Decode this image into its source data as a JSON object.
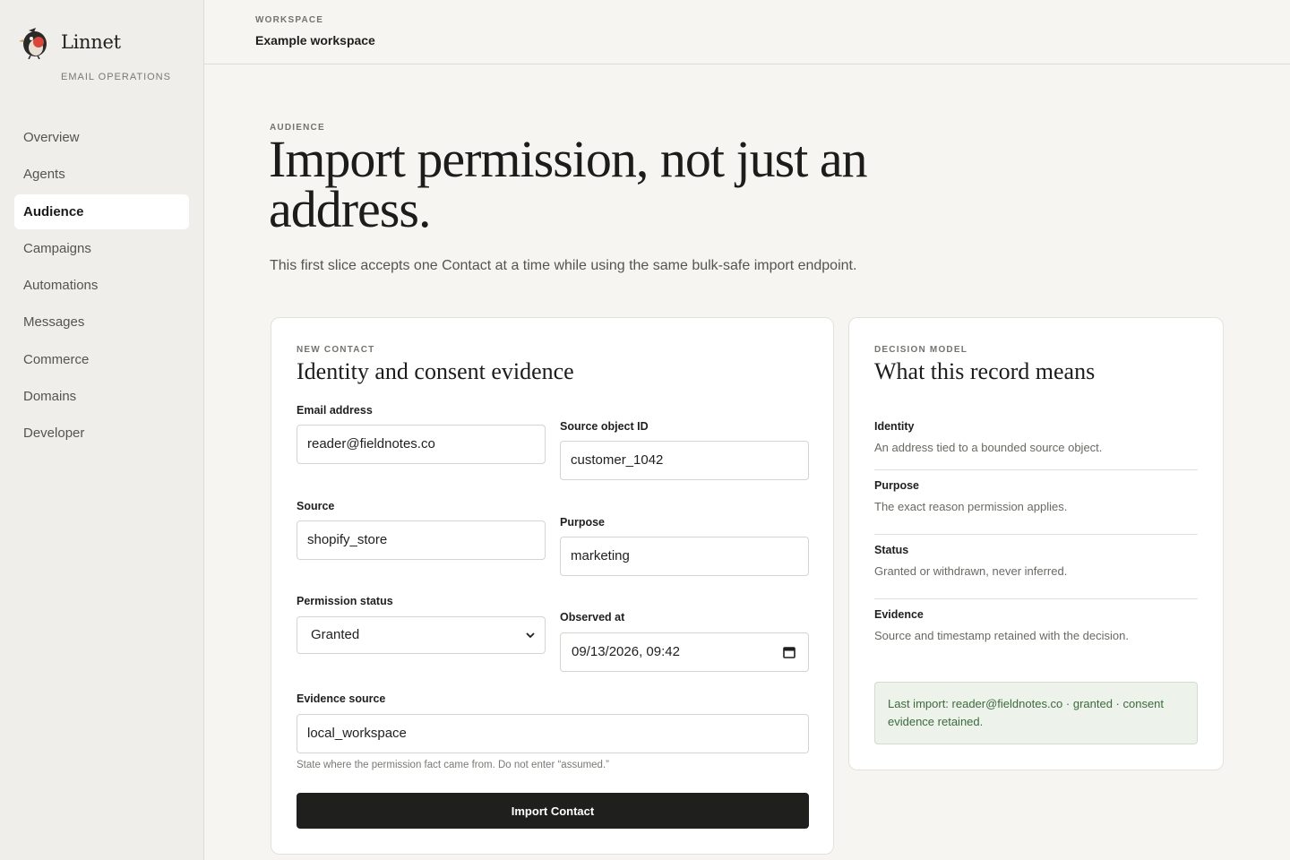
{
  "brand": {
    "name": "Linnet",
    "tagline": "EMAIL OPERATIONS",
    "logo_icon": "bird-logo-icon"
  },
  "sidebar": {
    "items": [
      {
        "label": "Overview",
        "active": false
      },
      {
        "label": "Agents",
        "active": false
      },
      {
        "label": "Audience",
        "active": true
      },
      {
        "label": "Campaigns",
        "active": false
      },
      {
        "label": "Automations",
        "active": false
      },
      {
        "label": "Messages",
        "active": false
      },
      {
        "label": "Commerce",
        "active": false
      },
      {
        "label": "Domains",
        "active": false
      },
      {
        "label": "Developer",
        "active": false
      }
    ]
  },
  "workspace": {
    "eyebrow": "WORKSPACE",
    "name": "Example workspace"
  },
  "hero": {
    "eyebrow": "AUDIENCE",
    "title": "Import permission, not just an address.",
    "subtitle": "This first slice accepts one Contact at a time while using the same bulk-safe import endpoint."
  },
  "form": {
    "eyebrow": "NEW CONTACT",
    "title": "Identity and consent evidence",
    "email": {
      "label": "Email address",
      "value": "reader@fieldnotes.co"
    },
    "source_object_id": {
      "label": "Source object ID",
      "value": "customer_1042"
    },
    "source": {
      "label": "Source",
      "value": "shopify_store"
    },
    "purpose": {
      "label": "Purpose",
      "value": "marketing"
    },
    "permission_status": {
      "label": "Permission status",
      "value": "Granted"
    },
    "observed_at": {
      "label": "Observed at",
      "value": "09/13/2026, 09:42"
    },
    "evidence_source": {
      "label": "Evidence source",
      "value": "local_workspace"
    },
    "help_text": "State where the permission fact came from. Do not enter “assumed.”",
    "submit_label": "Import Contact"
  },
  "decision_model": {
    "eyebrow": "DECISION MODEL",
    "title": "What this record means",
    "items": [
      {
        "label": "Identity",
        "description": "An address tied to a bounded source object."
      },
      {
        "label": "Purpose",
        "description": "The exact reason permission applies."
      },
      {
        "label": "Status",
        "description": "Granted or withdrawn, never inferred."
      },
      {
        "label": "Evidence",
        "description": "Source and timestamp retained with the decision."
      }
    ],
    "last_import": "Last import: reader@fieldnotes.co · granted · consent evidence retained."
  },
  "colors": {
    "background": "#f6f5f1",
    "sidebar": "#efeeea",
    "primary_button": "#1f201e",
    "success_bg": "#edf2ea",
    "success_text": "#3d6b3d"
  }
}
